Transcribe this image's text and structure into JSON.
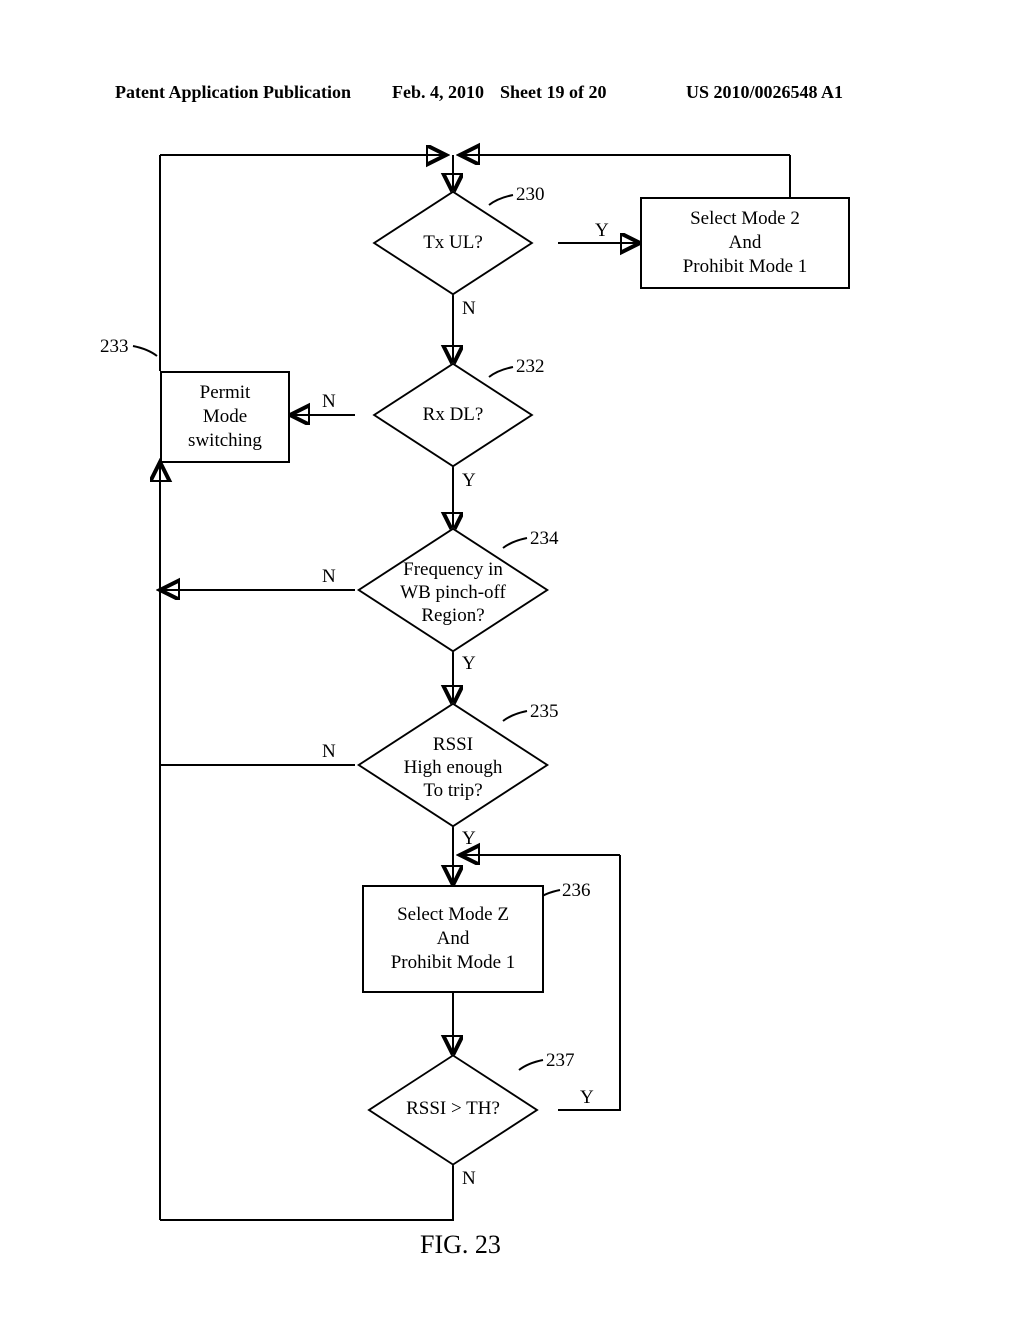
{
  "header": {
    "left": "Patent Application Publication",
    "date": "Feb. 4, 2010",
    "sheet": "Sheet 19 of 20",
    "pubno": "US 2010/0026548 A1"
  },
  "refs": {
    "r230": "230",
    "r232": "232",
    "r233": "233",
    "r234": "234",
    "r235": "235",
    "r236": "236",
    "r237": "237"
  },
  "nodes": {
    "d230": "Tx UL?",
    "d232": "Rx DL?",
    "d234": "Frequency in\nWB pinch-off\nRegion?",
    "d235": "RSSI\nHigh enough\nTo trip?",
    "d237": "RSSI > TH?",
    "box231": "Select Mode 2\nAnd\nProhibit Mode 1",
    "box233": "Permit\nMode\nswitching",
    "box236": "Select Mode Z\nAnd\nProhibit Mode 1"
  },
  "edge_labels": {
    "y": "Y",
    "n": "N"
  },
  "figure": "FIG. 23",
  "chart_data": {
    "type": "flowchart",
    "title": "FIG. 23",
    "nodes": [
      {
        "id": "start",
        "type": "junction",
        "label": ""
      },
      {
        "id": "230",
        "type": "decision",
        "label": "Tx UL?"
      },
      {
        "id": "231",
        "type": "process",
        "label": "Select Mode 2 And Prohibit Mode 1"
      },
      {
        "id": "232",
        "type": "decision",
        "label": "Rx DL?"
      },
      {
        "id": "233",
        "type": "process",
        "label": "Permit Mode switching"
      },
      {
        "id": "234",
        "type": "decision",
        "label": "Frequency in WB pinch-off Region?"
      },
      {
        "id": "235",
        "type": "decision",
        "label": "RSSI High enough To trip?"
      },
      {
        "id": "236",
        "type": "process",
        "label": "Select Mode Z And Prohibit Mode 1"
      },
      {
        "id": "237",
        "type": "decision",
        "label": "RSSI > TH?"
      }
    ],
    "edges": [
      {
        "from": "start",
        "to": "230",
        "label": ""
      },
      {
        "from": "230",
        "to": "231",
        "label": "Y"
      },
      {
        "from": "230",
        "to": "232",
        "label": "N"
      },
      {
        "from": "231",
        "to": "start",
        "label": ""
      },
      {
        "from": "232",
        "to": "233",
        "label": "N"
      },
      {
        "from": "232",
        "to": "234",
        "label": "Y"
      },
      {
        "from": "233",
        "to": "start",
        "label": ""
      },
      {
        "from": "234",
        "to": "233",
        "label": "N"
      },
      {
        "from": "234",
        "to": "235",
        "label": "Y"
      },
      {
        "from": "235",
        "to": "233",
        "label": "N"
      },
      {
        "from": "235",
        "to": "236",
        "label": "Y"
      },
      {
        "from": "236",
        "to": "237",
        "label": ""
      },
      {
        "from": "237",
        "to": "236",
        "label": "Y"
      },
      {
        "from": "237",
        "to": "233",
        "label": "N"
      }
    ]
  }
}
